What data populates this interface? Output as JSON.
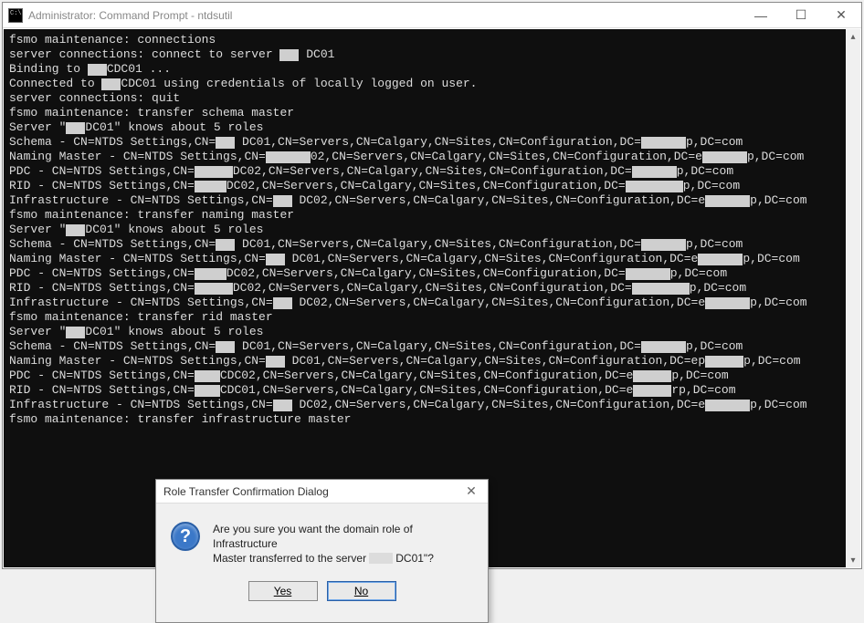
{
  "window": {
    "title": "Administrator: Command Prompt - ntdsutil",
    "controls": {
      "min": "—",
      "max": "☐",
      "close": "✕"
    }
  },
  "terminal": {
    "lines": [
      "fsmo maintenance: connections",
      "server connections: connect to server ███ DC01",
      "Binding to ███CDC01 ...",
      "Connected to ███CDC01 using credentials of locally logged on user.",
      "server connections: quit",
      "fsmo maintenance: transfer schema master",
      "Server \"███DC01\" knows about 5 roles",
      "Schema - CN=NTDS Settings,CN=███ DC01,CN=Servers,CN=Calgary,CN=Sites,CN=Configuration,DC=███████p,DC=com",
      "Naming Master - CN=NTDS Settings,CN=███████02,CN=Servers,CN=Calgary,CN=Sites,CN=Configuration,DC=e███████p,DC=com",
      "PDC - CN=NTDS Settings,CN=██████DC02,CN=Servers,CN=Calgary,CN=Sites,CN=Configuration,DC=███████p,DC=com",
      "RID - CN=NTDS Settings,CN=█████DC02,CN=Servers,CN=Calgary,CN=Sites,CN=Configuration,DC=█████████p,DC=com",
      "Infrastructure - CN=NTDS Settings,CN=███ DC02,CN=Servers,CN=Calgary,CN=Sites,CN=Configuration,DC=e███████p,DC=com",
      "fsmo maintenance: transfer naming master",
      "Server \"███DC01\" knows about 5 roles",
      "Schema - CN=NTDS Settings,CN=███ DC01,CN=Servers,CN=Calgary,CN=Sites,CN=Configuration,DC=███████p,DC=com",
      "Naming Master - CN=NTDS Settings,CN=███ DC01,CN=Servers,CN=Calgary,CN=Sites,CN=Configuration,DC=e███████p,DC=com",
      "PDC - CN=NTDS Settings,CN=█████DC02,CN=Servers,CN=Calgary,CN=Sites,CN=Configuration,DC=███████p,DC=com",
      "RID - CN=NTDS Settings,CN=██████DC02,CN=Servers,CN=Calgary,CN=Sites,CN=Configuration,DC=█████████p,DC=com",
      "Infrastructure - CN=NTDS Settings,CN=███ DC02,CN=Servers,CN=Calgary,CN=Sites,CN=Configuration,DC=e███████p,DC=com",
      "fsmo maintenance: transfer rid master",
      "Server \"███DC01\" knows about 5 roles",
      "Schema - CN=NTDS Settings,CN=███ DC01,CN=Servers,CN=Calgary,CN=Sites,CN=Configuration,DC=███████p,DC=com",
      "Naming Master - CN=NTDS Settings,CN=███ DC01,CN=Servers,CN=Calgary,CN=Sites,CN=Configuration,DC=ep██████p,DC=com",
      "PDC - CN=NTDS Settings,CN=████CDC02,CN=Servers,CN=Calgary,CN=Sites,CN=Configuration,DC=e██████p,DC=com",
      "RID - CN=NTDS Settings,CN=████CDC01,CN=Servers,CN=Calgary,CN=Sites,CN=Configuration,DC=e██████rp,DC=com",
      "Infrastructure - CN=NTDS Settings,CN=███ DC02,CN=Servers,CN=Calgary,CN=Sites,CN=Configuration,DC=e███████p,DC=com",
      "fsmo maintenance: transfer infrastructure master"
    ]
  },
  "dialog": {
    "title": "Role Transfer Confirmation Dialog",
    "icon_glyph": "?",
    "text_line1": "Are you sure you want the domain role of Infrastructure",
    "text_line2_a": "Master transferred to the server ",
    "text_line2_redacted": "███",
    "text_line2_b": " DC01\"?",
    "yes": "Yes",
    "no": "No",
    "close": "✕"
  }
}
